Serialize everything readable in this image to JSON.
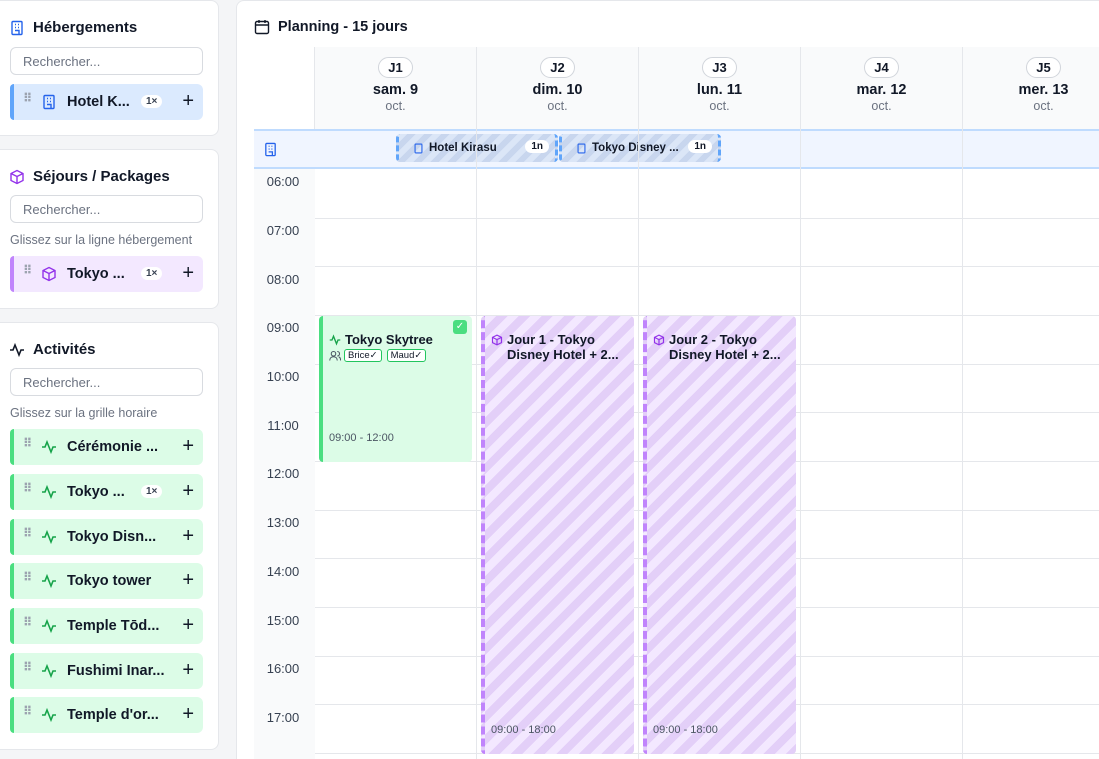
{
  "sidebar": {
    "hebergements": {
      "title": "Hébergements",
      "search_placeholder": "Rechercher...",
      "items": [
        {
          "label": "Hotel K...",
          "badge": "1×"
        }
      ]
    },
    "sejours": {
      "title": "Séjours / Packages",
      "search_placeholder": "Rechercher...",
      "hint": "Glissez sur la ligne hébergement",
      "items": [
        {
          "label": "Tokyo ...",
          "badge": "1×"
        }
      ]
    },
    "activites": {
      "title": "Activités",
      "search_placeholder": "Rechercher...",
      "hint": "Glissez sur la grille horaire",
      "items": [
        {
          "label": "Cérémonie ...",
          "badge": ""
        },
        {
          "label": "Tokyo ...",
          "badge": "1×"
        },
        {
          "label": "Tokyo Disn...",
          "badge": ""
        },
        {
          "label": "Tokyo tower",
          "badge": ""
        },
        {
          "label": "Temple Tōd...",
          "badge": ""
        },
        {
          "label": "Fushimi Inar...",
          "badge": ""
        },
        {
          "label": "Temple d'or...",
          "badge": ""
        }
      ]
    }
  },
  "planning": {
    "title": "Planning - 15 jours",
    "days": [
      {
        "j": "J1",
        "label": "sam. 9",
        "month": "oct."
      },
      {
        "j": "J2",
        "label": "dim. 10",
        "month": "oct."
      },
      {
        "j": "J3",
        "label": "lun. 11",
        "month": "oct."
      },
      {
        "j": "J4",
        "label": "mar. 12",
        "month": "oct."
      },
      {
        "j": "J5",
        "label": "mer. 13",
        "month": "oct."
      }
    ],
    "stays": [
      {
        "label": "Hotel Kirasu",
        "nights": "1n"
      },
      {
        "label": "Tokyo Disney ...",
        "nights": "1n"
      }
    ],
    "hours": [
      "06:00",
      "07:00",
      "08:00",
      "09:00",
      "10:00",
      "11:00",
      "12:00",
      "13:00",
      "14:00",
      "15:00",
      "16:00",
      "17:00"
    ],
    "events": [
      {
        "title": "Tokyo Skytree",
        "time": "09:00 - 12:00",
        "tags": [
          "Brice✓",
          "Maud✓"
        ]
      },
      {
        "title": "Jour 1 - Tokyo Disney Hotel + 2...",
        "time": "09:00 - 18:00"
      },
      {
        "title": "Jour 2 - Tokyo Disney Hotel + 2...",
        "time": "09:00 - 18:00"
      }
    ]
  },
  "colors": {
    "hotel": "#60a5fa",
    "package": "#c084fc",
    "activity": "#4ade80"
  },
  "icons": {
    "hotel": "building-icon",
    "package": "box-icon",
    "activity": "activity-icon",
    "calendar": "calendar-icon"
  }
}
